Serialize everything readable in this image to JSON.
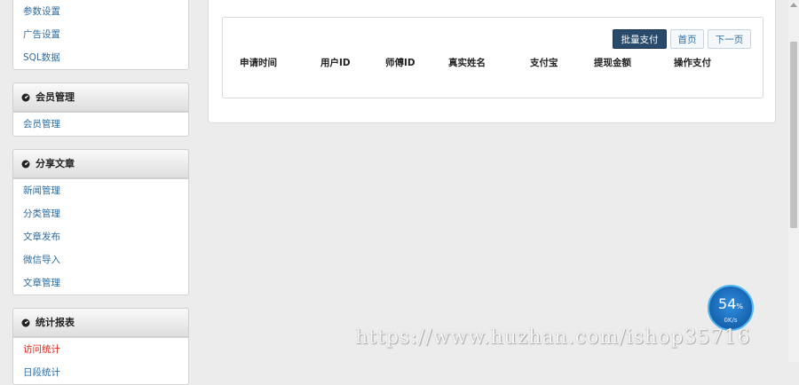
{
  "sidebar": {
    "top_items": [
      "参数设置",
      "广告设置",
      "SQL数据"
    ],
    "panels": [
      {
        "title": "会员管理",
        "icon": "dashboard-icon",
        "items": [
          "会员管理"
        ]
      },
      {
        "title": "分享文章",
        "icon": "dashboard-icon",
        "items": [
          "新闻管理",
          "分类管理",
          "文章发布",
          "微信导入",
          "文章管理"
        ]
      },
      {
        "title": "统计报表",
        "icon": "dashboard-icon",
        "items": [
          "访问统计",
          "日段统计"
        ],
        "active_item": "访问统计"
      }
    ]
  },
  "toolbar": {
    "batch_pay": "批量支付",
    "first_page": "首页",
    "next_page": "下一页"
  },
  "table": {
    "columns": [
      "申请时间",
      "用户ID",
      "师傅ID",
      "真实姓名",
      "支付宝",
      "提现金额",
      "操作支付"
    ]
  },
  "speed_widget": {
    "percent": "54",
    "percent_unit": "%",
    "rate": "0K/s"
  },
  "watermark": "https://www.huzhan.com/ishop35716",
  "colors": {
    "link": "#2d6ca2",
    "active_link": "#d9261c",
    "primary_button": "#2a4a6b"
  }
}
